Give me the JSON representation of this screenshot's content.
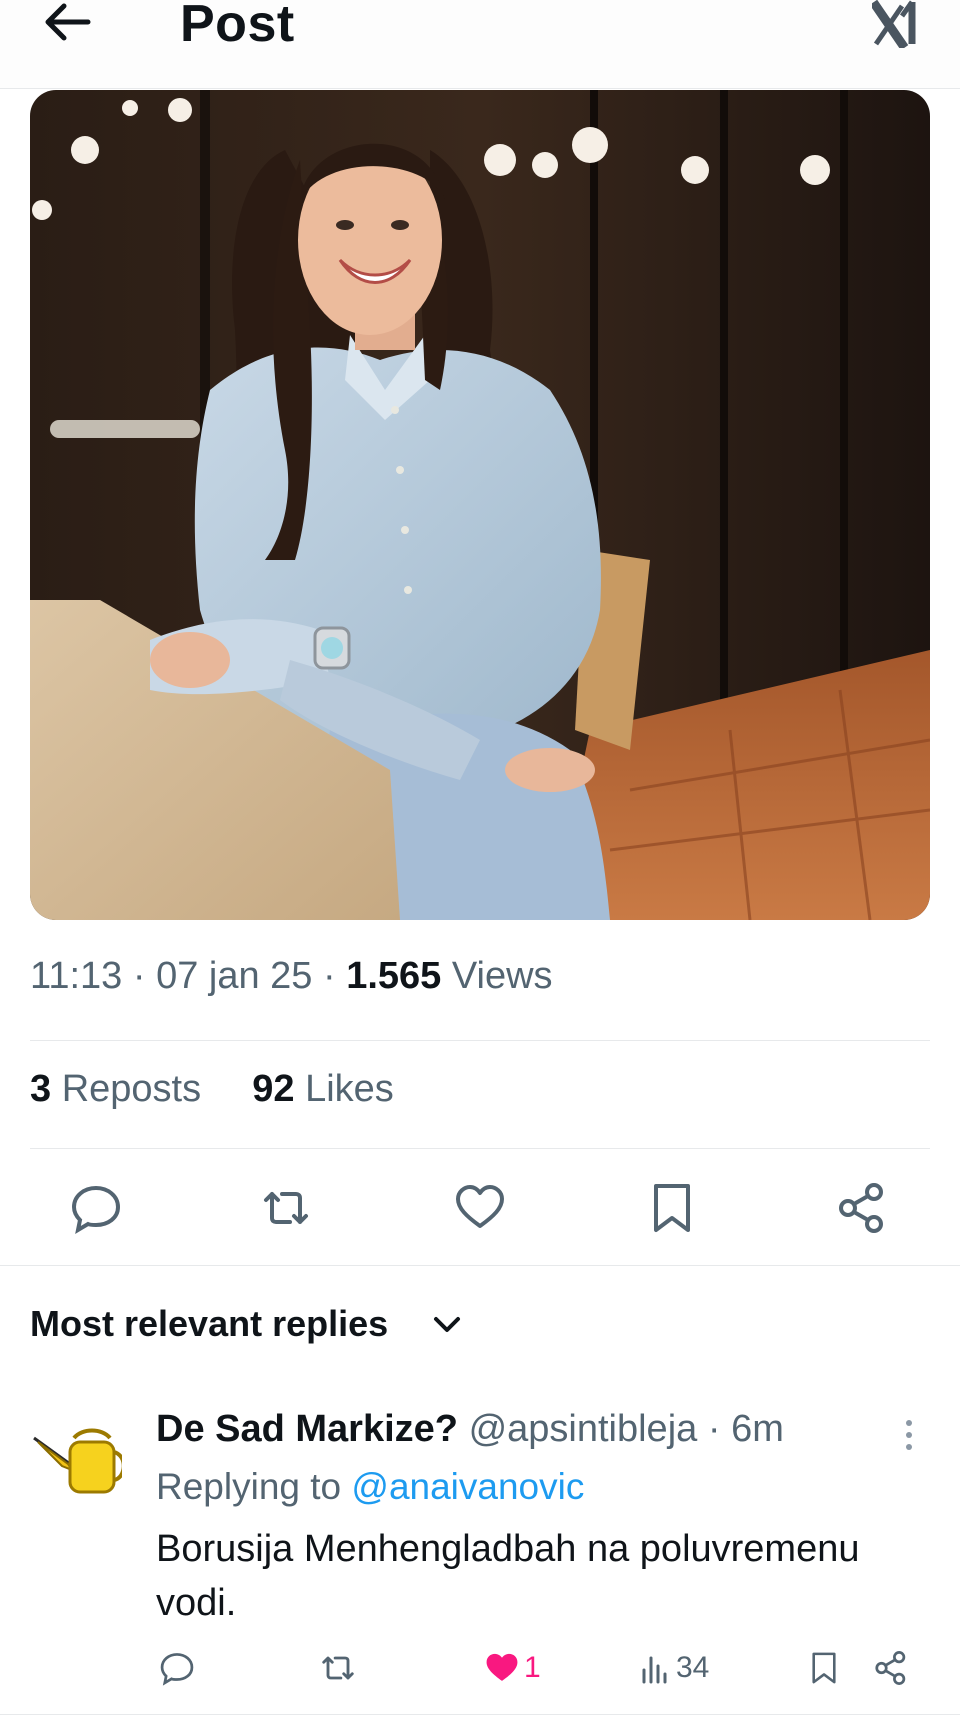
{
  "header": {
    "title": "Post",
    "back_icon": "arrow-left-icon",
    "logo_icon": "x-logo-icon"
  },
  "post": {
    "image_alt": "Smiling woman in light blue shirt sitting at a table",
    "time": "11:13",
    "date": "07 jan 25",
    "views_count": "1.565",
    "views_label": "Views",
    "reposts_count": "3",
    "reposts_label": "Reposts",
    "likes_count": "92",
    "likes_label": "Likes",
    "actions": [
      "reply-icon",
      "repost-icon",
      "like-icon",
      "bookmark-icon",
      "share-icon"
    ]
  },
  "replies": {
    "header_label": "Most relevant replies",
    "items": [
      {
        "display_name": "De Sad Markize?",
        "handle": "@apsintibleja",
        "age": "6m",
        "replying_prefix": "Replying to",
        "replying_to": "@anaivanovic",
        "text": "Borusija Menhengladbah na poluvremenu vodi.",
        "likes": "1",
        "views": "34"
      }
    ]
  },
  "colors": {
    "accent": "#1d9bf0",
    "muted": "#536471",
    "like": "#f91880",
    "text": "#0f1419"
  }
}
